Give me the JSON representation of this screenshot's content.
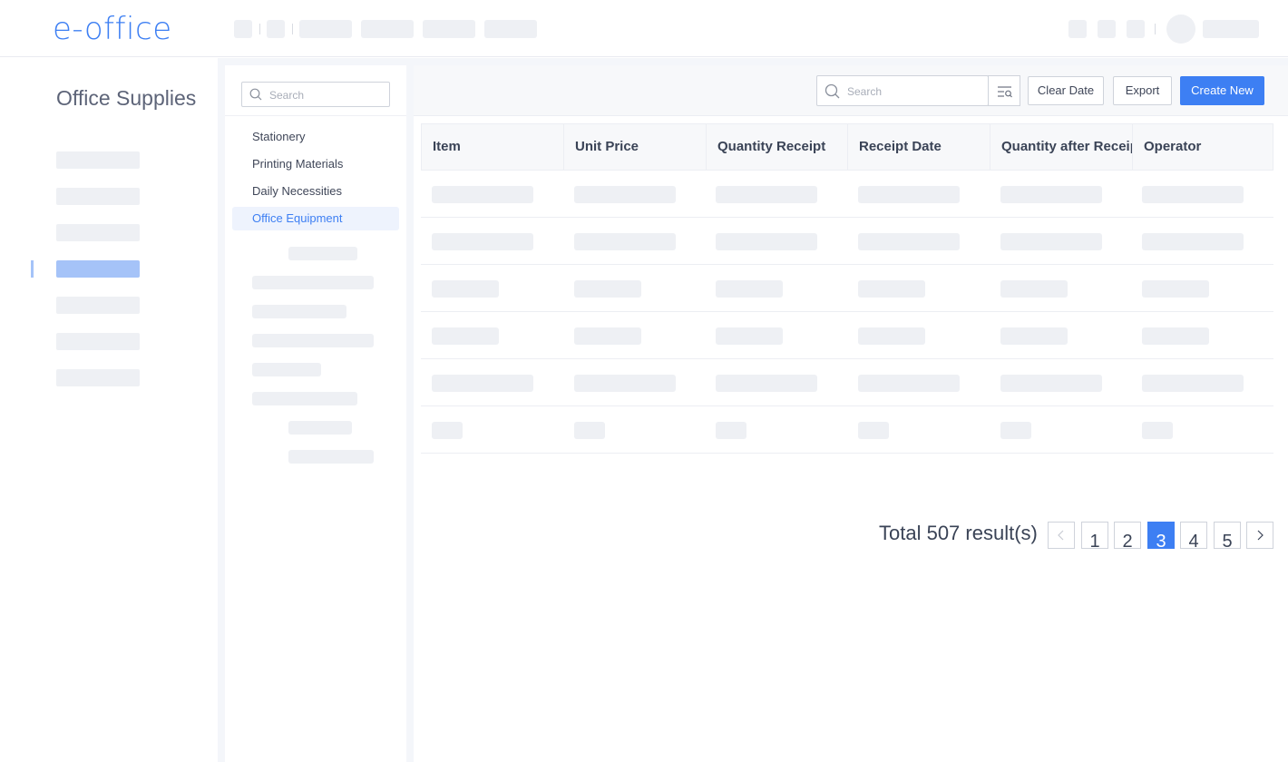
{
  "app": {
    "logo": "e-office"
  },
  "sidebar": {
    "module_title": "Office Supplies"
  },
  "categories": {
    "search_placeholder": "Search",
    "items": [
      {
        "label": "Stationery",
        "active": false
      },
      {
        "label": "Printing Materials",
        "active": false
      },
      {
        "label": "Daily Necessities",
        "active": false
      },
      {
        "label": "Office Equipment",
        "active": true
      }
    ]
  },
  "toolbar": {
    "search_placeholder": "Search",
    "clear_date_label": "Clear Date",
    "export_label": "Export",
    "create_new_label": "Create New"
  },
  "table": {
    "columns": [
      "Item",
      "Unit Price",
      "Quantity Receipt",
      "Receipt Date",
      "Quantity after Receipt",
      "Operator"
    ]
  },
  "pagination": {
    "total_text": "Total 507 result(s)",
    "pages": [
      "1",
      "2",
      "3",
      "4",
      "5"
    ],
    "current_page": "3",
    "prev_icon": "chevron-left-icon",
    "next_icon": "chevron-right-icon"
  },
  "colors": {
    "accent": "#3d7ff3",
    "active_nav": "#a5c3f8",
    "skeleton": "#eef0f4"
  }
}
